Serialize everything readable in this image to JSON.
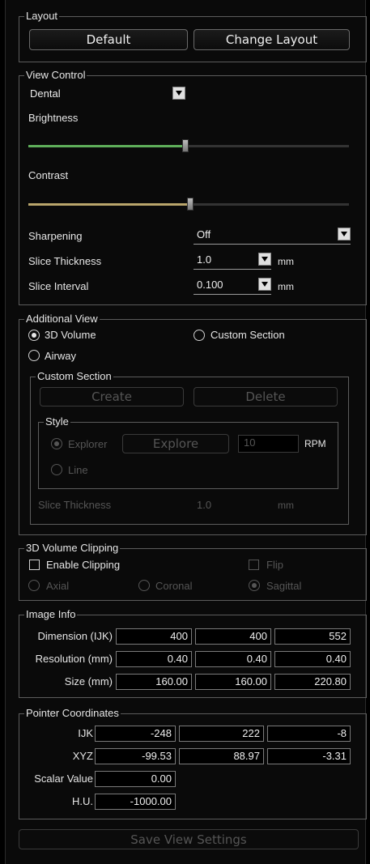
{
  "layout": {
    "title": "Layout",
    "default_label": "Default",
    "change_label": "Change Layout"
  },
  "view_control": {
    "title": "View Control",
    "preset": "Dental",
    "brightness_label": "Brightness",
    "brightness_level": 0.49,
    "brightness_color": "#5fae5a",
    "contrast_label": "Contrast",
    "contrast_level": 0.505,
    "contrast_color": "#b9a56b",
    "sharpening_label": "Sharpening",
    "sharpening_value": "Off",
    "slice_thickness_label": "Slice Thickness",
    "slice_thickness_value": "1.0",
    "slice_thickness_unit": "mm",
    "slice_interval_label": "Slice Interval",
    "slice_interval_value": "0.100",
    "slice_interval_unit": "mm"
  },
  "additional_view": {
    "title": "Additional View",
    "opt_3d_volume": "3D Volume",
    "opt_custom_section": "Custom Section",
    "opt_airway": "Airway",
    "custom_section": {
      "title": "Custom Section",
      "create_label": "Create",
      "delete_label": "Delete",
      "style": {
        "title": "Style",
        "explorer_label": "Explorer",
        "explore_button": "Explore",
        "rpm_value": "10",
        "rpm_unit": "RPM",
        "line_label": "Line"
      },
      "slice_thickness_label": "Slice Thickness",
      "slice_thickness_value": "1.0",
      "slice_thickness_unit": "mm"
    }
  },
  "clipping": {
    "title": "3D Volume Clipping",
    "enable_label": "Enable Clipping",
    "flip_label": "Flip",
    "axial_label": "Axial",
    "coronal_label": "Coronal",
    "sagittal_label": "Sagittal"
  },
  "image_info": {
    "title": "Image Info",
    "rows": [
      {
        "label": "Dimension (IJK)",
        "values": [
          "400",
          "400",
          "552"
        ]
      },
      {
        "label": "Resolution (mm)",
        "values": [
          "0.40",
          "0.40",
          "0.40"
        ]
      },
      {
        "label": "Size (mm)",
        "values": [
          "160.00",
          "160.00",
          "220.80"
        ]
      }
    ]
  },
  "pointer": {
    "title": "Pointer Coordinates",
    "ijk_label": "IJK",
    "ijk": [
      "-248",
      "222",
      "-8"
    ],
    "xyz_label": "XYZ",
    "xyz": [
      "-99.53",
      "88.97",
      "-3.31"
    ],
    "scalar_label": "Scalar Value",
    "scalar_value": "0.00",
    "hu_label": "H.U.",
    "hu_value": "-1000.00"
  },
  "save_label": "Save View Settings"
}
